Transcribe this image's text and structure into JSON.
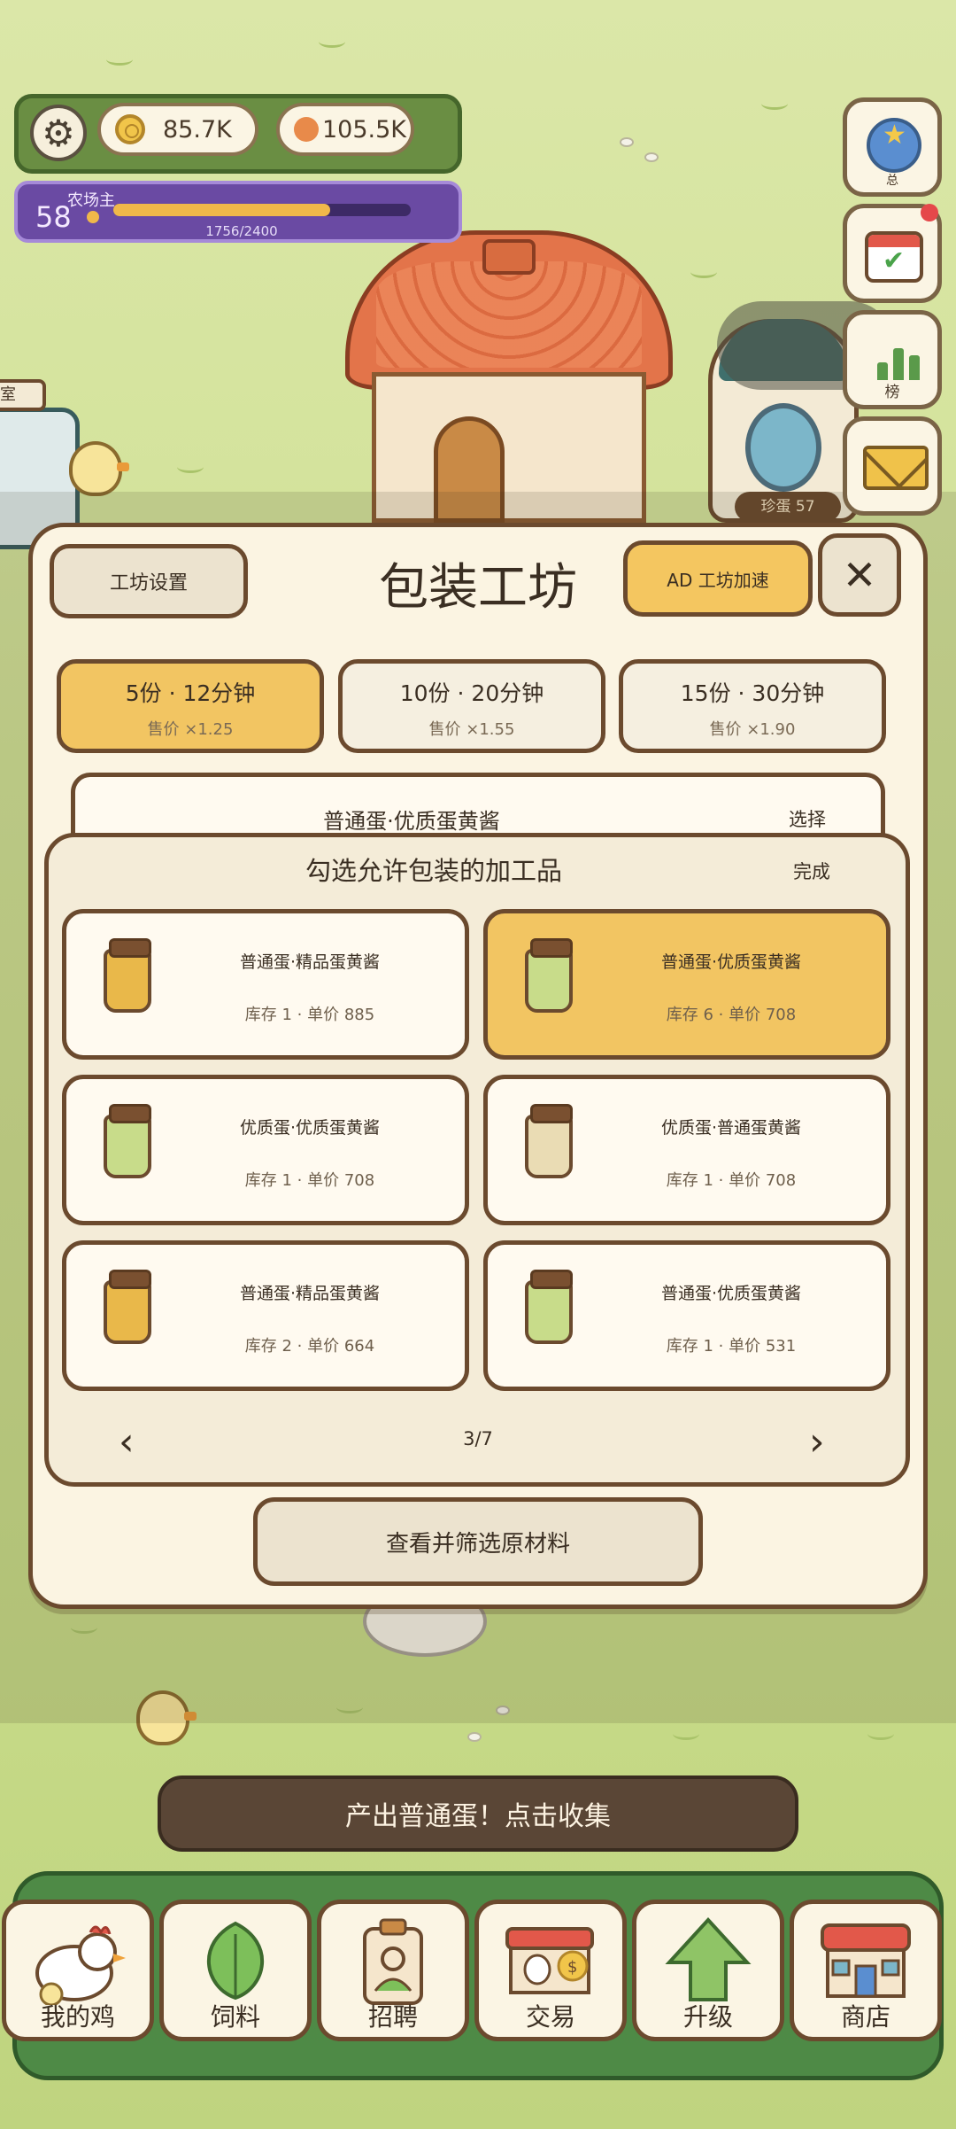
{
  "hud": {
    "coins": "85.7K",
    "eggs": "105.5K",
    "level": "58",
    "level_title": "农场主",
    "xp_text": "1756/2400",
    "xp_fraction": 0.73
  },
  "scene": {
    "greenhouse_sign": "室",
    "machine_label": "珍蛋 57"
  },
  "side": {
    "rank_label": "榜",
    "top_label": "总"
  },
  "modal": {
    "settings_label": "工坊设置",
    "title": "包装工坊",
    "speed_label": "AD 工坊加速",
    "close_glyph": "✕",
    "options": [
      {
        "main": "5份 · 12分钟",
        "sub": "售价 ×1.25",
        "selected": true
      },
      {
        "main": "10份 · 20分钟",
        "sub": "售价 ×1.55",
        "selected": false
      },
      {
        "main": "15份 · 30分钟",
        "sub": "售价 ×1.90",
        "selected": false
      }
    ],
    "current_product": "普通蛋·优质蛋黄酱",
    "current_pick": "选择",
    "picker": {
      "title": "勾选允许包装的加工品",
      "done": "完成",
      "items": [
        {
          "name": "普通蛋·精品蛋黄酱",
          "meta": "库存 1 · 单价 885",
          "jar_color": "#e9b84a",
          "selected": false
        },
        {
          "name": "普通蛋·优质蛋黄酱",
          "meta": "库存 6 · 单价 708",
          "jar_color": "#c8dc8a",
          "selected": true
        },
        {
          "name": "优质蛋·优质蛋黄酱",
          "meta": "库存 1 · 单价 708",
          "jar_color": "#c8dc8a",
          "selected": false
        },
        {
          "name": "优质蛋·普通蛋黄酱",
          "meta": "库存 1 · 单价 708",
          "jar_color": "#eadcb4",
          "selected": false
        },
        {
          "name": "普通蛋·精品蛋黄酱",
          "meta": "库存 2 · 单价 664",
          "jar_color": "#e9b84a",
          "selected": false
        },
        {
          "name": "普通蛋·优质蛋黄酱",
          "meta": "库存 1 · 单价 531",
          "jar_color": "#c8dc8a",
          "selected": false
        }
      ],
      "prev": "‹",
      "next": "›",
      "page": "3/7"
    },
    "filter_label": "查看并筛选原材料"
  },
  "collect_label": "产出普通蛋！点击收集",
  "nav": [
    {
      "label": "我的鸡",
      "icon": "chicken-icon"
    },
    {
      "label": "饲料",
      "icon": "leaf-icon"
    },
    {
      "label": "招聘",
      "icon": "badge-icon"
    },
    {
      "label": "交易",
      "icon": "market-icon"
    },
    {
      "label": "升级",
      "icon": "arrow-up-icon"
    },
    {
      "label": "商店",
      "icon": "shop-icon"
    }
  ],
  "colors": {
    "accent_gold": "#f4c660",
    "border_brown": "#6b4a2e",
    "hud_green": "#6a8e43",
    "level_purple": "#6a4aa3"
  }
}
